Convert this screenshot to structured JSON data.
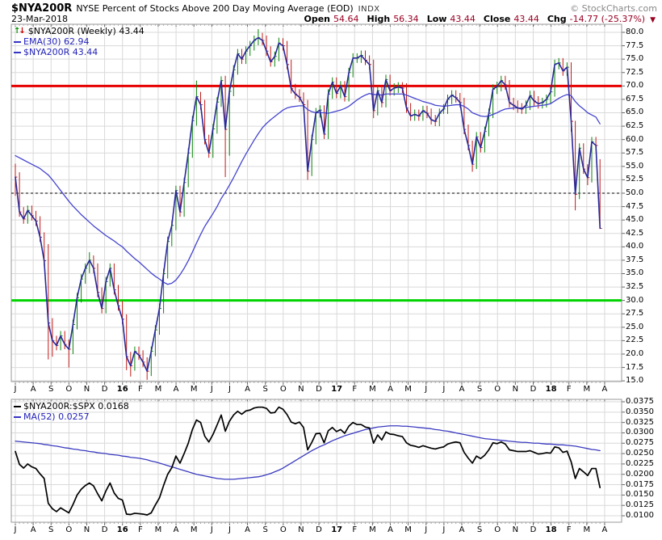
{
  "header": {
    "symbol": "$NYA200R",
    "title": "NYSE Percent of Stocks Above 200 Day Moving Average (EOD)",
    "exchange": "INDX",
    "watermark": "© StockCharts.com",
    "date": "23-Mar-2018",
    "quote": {
      "open_label": "Open",
      "open": "54.64",
      "high_label": "High",
      "high": "56.34",
      "low_label": "Low",
      "low": "43.44",
      "close_label": "Close",
      "close": "43.44",
      "chg_label": "Chg",
      "chg": "-14.77 (-25.37%)"
    }
  },
  "main_panel": {
    "legend": [
      {
        "label": "$NYA200R (Weekly) 43.44",
        "color": "#000000",
        "icon": "updown-arrows"
      },
      {
        "label": "EMA(30) 62.94",
        "color": "#2222bb",
        "icon": "line-sample"
      },
      {
        "label": "$NYA200R 43.44",
        "color": "#2222bb",
        "icon": "line-sample"
      }
    ],
    "y_ticks": [
      "80.0",
      "77.5",
      "75.0",
      "72.5",
      "70.0",
      "67.5",
      "65.0",
      "62.5",
      "60.0",
      "57.5",
      "55.0",
      "52.5",
      "50.0",
      "47.5",
      "45.0",
      "42.5",
      "40.0",
      "37.5",
      "35.0",
      "32.5",
      "30.0",
      "27.5",
      "25.0",
      "22.5",
      "20.0",
      "17.5",
      "15.0"
    ]
  },
  "lower_panel": {
    "legend": [
      {
        "label": "$NYA200R:$SPX 0.0168",
        "color": "#000000",
        "icon": "line-sample"
      },
      {
        "label": "MA(52) 0.0257",
        "color": "#2222bb",
        "icon": "line-sample"
      }
    ],
    "y_ticks": [
      "0.0375",
      "0.0350",
      "0.0325",
      "0.0300",
      "0.0275",
      "0.0250",
      "0.0225",
      "0.0200",
      "0.0175",
      "0.0150",
      "0.0125",
      "0.0100"
    ]
  },
  "x_axis": {
    "months": [
      "J",
      "A",
      "S",
      "O",
      "N",
      "D",
      "16",
      "F",
      "M",
      "A",
      "M",
      "J",
      "J",
      "A",
      "S",
      "O",
      "N",
      "D",
      "17",
      "F",
      "M",
      "A",
      "M",
      "J",
      "J",
      "A",
      "S",
      "O",
      "N",
      "D",
      "18",
      "F",
      "M",
      "A"
    ]
  },
  "chart_data": {
    "type": "ohlc+line",
    "frequency": "weekly",
    "x_range": "Jul-2015 to Apr-2018",
    "main": {
      "ylabel": "Percent of stocks above 200-day MA",
      "ylim": [
        15.0,
        80.0
      ],
      "grid_step": 2.5,
      "up_color": "#0a830a",
      "down_color": "#c11b17",
      "close_line_color": "#28289a",
      "ema_color": "#4444cf",
      "hlines": [
        {
          "value": 70.0,
          "color": "#e60000",
          "width": 3,
          "style": "solid"
        },
        {
          "value": 50.0,
          "color": "#000000",
          "width": 1,
          "style": "dashed"
        },
        {
          "value": 30.0,
          "color": "#00d300",
          "width": 3,
          "style": "solid"
        }
      ],
      "close": [
        53.0,
        46.5,
        45.2,
        46.8,
        45.8,
        44.8,
        41.8,
        37.4,
        25.8,
        22.5,
        21.6,
        23.4,
        21.8,
        20.9,
        25.5,
        30.5,
        34.0,
        36.0,
        37.5,
        36.0,
        31.5,
        28.5,
        33.5,
        36.0,
        32.0,
        29.0,
        26.5,
        19.5,
        17.8,
        20.5,
        19.8,
        18.5,
        16.8,
        20.5,
        24.5,
        28.5,
        35.0,
        41.0,
        44.0,
        50.5,
        46.5,
        52.0,
        57.5,
        63.5,
        68.0,
        66.5,
        60.0,
        57.5,
        62.0,
        67.0,
        71.0,
        61.9,
        69.0,
        73.0,
        76.0,
        75.0,
        76.5,
        77.5,
        78.5,
        79.0,
        78.5,
        76.5,
        74.5,
        75.5,
        78.0,
        77.5,
        74.0,
        69.5,
        68.5,
        67.9,
        66.5,
        54.1,
        60.0,
        65.0,
        65.5,
        61.0,
        68.5,
        70.7,
        68.6,
        70.0,
        68.0,
        72.5,
        75.2,
        75.2,
        75.7,
        74.8,
        74.0,
        65.4,
        69.1,
        66.9,
        71.2,
        69.1,
        69.6,
        69.8,
        69.6,
        65.9,
        64.4,
        64.7,
        64.4,
        65.4,
        64.9,
        63.7,
        63.4,
        64.9,
        65.7,
        67.5,
        68.3,
        67.8,
        66.9,
        61.9,
        58.9,
        55.4,
        60.5,
        58.5,
        61.5,
        64.9,
        69.4,
        69.9,
        71.0,
        70.2,
        66.9,
        66.4,
        65.9,
        65.7,
        66.4,
        68.2,
        67.2,
        66.7,
        66.9,
        67.5,
        68.9,
        74.0,
        74.3,
        72.8,
        73.5,
        63.4,
        49.8,
        58.4,
        54.5,
        52.9,
        59.6,
        58.9,
        43.44
      ],
      "high": [
        55.5,
        53.9,
        47.4,
        47.7,
        47.7,
        46.7,
        45.7,
        42.7,
        40.5,
        26.7,
        23.4,
        24.3,
        24.3,
        22.7,
        26.4,
        31.4,
        34.9,
        36.9,
        39.0,
        38.4,
        36.9,
        32.4,
        34.4,
        36.9,
        36.9,
        32.9,
        29.9,
        27.4,
        20.4,
        21.4,
        21.4,
        20.7,
        19.4,
        21.4,
        25.4,
        29.4,
        35.9,
        41.9,
        44.9,
        51.4,
        51.4,
        52.9,
        58.4,
        64.4,
        71.0,
        68.9,
        67.4,
        60.9,
        62.9,
        67.9,
        71.8,
        71.9,
        70.0,
        73.9,
        76.9,
        76.9,
        77.4,
        78.4,
        79.4,
        80.6,
        79.9,
        79.4,
        77.4,
        76.4,
        79.0,
        78.9,
        78.4,
        74.9,
        70.4,
        69.4,
        68.8,
        67.4,
        60.9,
        65.9,
        66.4,
        66.4,
        69.4,
        71.6,
        71.6,
        70.9,
        70.9,
        73.4,
        76.1,
        76.1,
        76.6,
        76.6,
        75.7,
        74.9,
        70.0,
        70.0,
        72.1,
        72.1,
        70.5,
        70.7,
        70.7,
        70.5,
        66.8,
        65.6,
        65.6,
        66.3,
        66.3,
        65.8,
        64.6,
        65.8,
        66.6,
        68.4,
        69.2,
        69.2,
        68.7,
        67.8,
        62.8,
        59.8,
        61.4,
        61.4,
        62.4,
        65.8,
        70.3,
        70.8,
        71.9,
        71.9,
        71.1,
        67.8,
        67.3,
        66.8,
        67.3,
        69.1,
        69.1,
        68.1,
        67.8,
        68.4,
        69.8,
        74.9,
        75.2,
        75.2,
        74.4,
        74.4,
        63.5,
        59.3,
        59.3,
        55.4,
        60.5,
        60.5,
        56.34
      ],
      "low": [
        49.5,
        45.6,
        44.3,
        44.3,
        44.9,
        43.9,
        40.9,
        36.5,
        19.0,
        19.5,
        20.7,
        20.7,
        20.9,
        17.5,
        20.0,
        24.6,
        29.6,
        33.1,
        35.1,
        35.1,
        30.6,
        27.6,
        27.6,
        32.6,
        31.1,
        28.1,
        25.6,
        17.0,
        15.8,
        16.9,
        18.9,
        17.6,
        15.2,
        15.9,
        19.6,
        23.6,
        27.6,
        34.1,
        40.1,
        43.1,
        45.6,
        45.6,
        51.1,
        56.6,
        62.6,
        65.6,
        59.1,
        56.6,
        56.6,
        61.1,
        66.1,
        53.0,
        57.0,
        68.1,
        72.1,
        74.1,
        74.1,
        75.6,
        76.6,
        77.6,
        77.6,
        75.6,
        73.6,
        73.6,
        74.6,
        76.6,
        73.1,
        68.6,
        67.6,
        67.0,
        65.6,
        52.5,
        53.2,
        59.1,
        64.1,
        60.1,
        60.1,
        67.6,
        67.7,
        67.7,
        67.1,
        67.1,
        71.6,
        74.3,
        74.3,
        73.9,
        73.1,
        64.0,
        64.5,
        66.0,
        66.0,
        68.2,
        68.2,
        68.7,
        68.7,
        65.0,
        63.5,
        63.5,
        63.5,
        63.5,
        64.0,
        62.8,
        62.5,
        62.5,
        64.8,
        64.8,
        66.6,
        66.9,
        66.0,
        61.0,
        58.0,
        54.0,
        54.5,
        57.6,
        57.6,
        60.6,
        64.0,
        68.5,
        69.0,
        69.3,
        66.0,
        65.5,
        65.0,
        64.8,
        64.8,
        65.5,
        66.3,
        65.8,
        65.8,
        66.0,
        66.6,
        68.0,
        73.1,
        71.9,
        71.9,
        61.5,
        46.8,
        48.9,
        53.6,
        51.5,
        52.0,
        58.0,
        43.44
      ],
      "ema30": [
        57.0,
        56.6,
        56.2,
        55.8,
        55.4,
        55.0,
        54.6,
        54.0,
        53.4,
        52.5,
        51.5,
        50.5,
        49.5,
        48.5,
        47.6,
        46.8,
        46.0,
        45.3,
        44.6,
        43.9,
        43.3,
        42.7,
        42.1,
        41.6,
        41.1,
        40.5,
        40.0,
        39.2,
        38.5,
        37.8,
        37.2,
        36.5,
        35.8,
        35.1,
        34.5,
        34.0,
        33.4,
        33.0,
        33.2,
        33.8,
        34.8,
        36.0,
        37.4,
        39.0,
        40.7,
        42.3,
        43.8,
        45.0,
        46.2,
        47.5,
        49.0,
        50.2,
        51.5,
        52.9,
        54.4,
        55.9,
        57.3,
        58.6,
        59.9,
        61.1,
        62.2,
        63.0,
        63.7,
        64.3,
        64.9,
        65.5,
        65.9,
        66.1,
        66.2,
        66.3,
        66.3,
        65.6,
        65.2,
        65.0,
        65.0,
        65.0,
        64.9,
        65.1,
        65.3,
        65.5,
        65.8,
        66.2,
        66.8,
        67.4,
        67.9,
        68.3,
        68.6,
        68.4,
        68.4,
        68.3,
        68.5,
        68.5,
        68.5,
        68.5,
        68.5,
        68.3,
        68.0,
        67.7,
        67.4,
        67.1,
        66.9,
        66.7,
        66.4,
        66.3,
        66.2,
        66.3,
        66.4,
        66.5,
        66.5,
        66.2,
        65.7,
        65.0,
        64.7,
        64.4,
        64.3,
        64.4,
        64.7,
        65.0,
        65.4,
        65.7,
        65.8,
        65.9,
        65.9,
        65.9,
        66.0,
        66.1,
        66.2,
        66.3,
        66.4,
        66.5,
        66.7,
        67.2,
        67.7,
        68.1,
        68.4,
        68.2,
        67.1,
        66.3,
        65.7,
        65.0,
        64.6,
        64.2,
        62.94
      ]
    },
    "lower": {
      "ylabel": "$NYA200R:$SPX ratio",
      "ylim": [
        0.01,
        0.0375
      ],
      "grid_step": 0.0025,
      "ratio_color": "#000000",
      "ma_color": "#3a3ac0",
      "ratio": [
        0.0255,
        0.0224,
        0.0215,
        0.0225,
        0.0218,
        0.0214,
        0.0201,
        0.019,
        0.013,
        0.0117,
        0.011,
        0.0119,
        0.0113,
        0.0107,
        0.0127,
        0.015,
        0.0164,
        0.0173,
        0.0179,
        0.0172,
        0.0153,
        0.0136,
        0.016,
        0.0179,
        0.0155,
        0.0142,
        0.0138,
        0.0104,
        0.0103,
        0.0106,
        0.0105,
        0.0104,
        0.0102,
        0.0107,
        0.0126,
        0.0143,
        0.0173,
        0.02,
        0.0216,
        0.0244,
        0.0227,
        0.025,
        0.0275,
        0.0308,
        0.0331,
        0.0325,
        0.0292,
        0.0278,
        0.0296,
        0.0319,
        0.0343,
        0.0304,
        0.0328,
        0.0343,
        0.0352,
        0.0345,
        0.0353,
        0.0355,
        0.036,
        0.0362,
        0.0362,
        0.0359,
        0.0348,
        0.0349,
        0.0362,
        0.0357,
        0.0344,
        0.0326,
        0.0322,
        0.0326,
        0.0313,
        0.0259,
        0.0277,
        0.0298,
        0.0299,
        0.0276,
        0.0305,
        0.0313,
        0.0303,
        0.0308,
        0.0299,
        0.0316,
        0.0325,
        0.032,
        0.032,
        0.0314,
        0.0312,
        0.0275,
        0.0295,
        0.0283,
        0.0302,
        0.0297,
        0.0296,
        0.0293,
        0.0291,
        0.0276,
        0.027,
        0.0268,
        0.0265,
        0.0269,
        0.0266,
        0.0263,
        0.0261,
        0.0264,
        0.0266,
        0.0273,
        0.0276,
        0.0278,
        0.0276,
        0.0253,
        0.0239,
        0.0227,
        0.0244,
        0.0238,
        0.0246,
        0.0259,
        0.0276,
        0.0274,
        0.0278,
        0.0273,
        0.0259,
        0.0257,
        0.0255,
        0.0255,
        0.0255,
        0.0257,
        0.0253,
        0.0249,
        0.025,
        0.0252,
        0.0251,
        0.0266,
        0.0264,
        0.0253,
        0.0256,
        0.023,
        0.019,
        0.0214,
        0.0206,
        0.0197,
        0.0214,
        0.0214,
        0.0168
      ],
      "ma52": [
        0.028,
        0.0279,
        0.0278,
        0.0277,
        0.0276,
        0.0275,
        0.0274,
        0.0272,
        0.0271,
        0.0269,
        0.0268,
        0.0266,
        0.0264,
        0.0263,
        0.0261,
        0.026,
        0.0258,
        0.0257,
        0.0255,
        0.0254,
        0.0252,
        0.0251,
        0.025,
        0.0248,
        0.0247,
        0.0246,
        0.0244,
        0.0243,
        0.0241,
        0.024,
        0.0239,
        0.0237,
        0.0235,
        0.0232,
        0.023,
        0.0227,
        0.0224,
        0.0221,
        0.0218,
        0.0215,
        0.0212,
        0.0209,
        0.0206,
        0.0203,
        0.02,
        0.0198,
        0.0196,
        0.0194,
        0.0192,
        0.019,
        0.0189,
        0.0188,
        0.0188,
        0.0188,
        0.0189,
        0.019,
        0.0191,
        0.0192,
        0.0193,
        0.0194,
        0.0196,
        0.0199,
        0.0202,
        0.0206,
        0.021,
        0.0215,
        0.0221,
        0.0227,
        0.0233,
        0.0239,
        0.0245,
        0.0251,
        0.0257,
        0.0262,
        0.0267,
        0.0271,
        0.0276,
        0.0281,
        0.0285,
        0.0289,
        0.0293,
        0.0296,
        0.0299,
        0.0302,
        0.0305,
        0.0308,
        0.031,
        0.0312,
        0.0314,
        0.0315,
        0.0316,
        0.0317,
        0.0317,
        0.0317,
        0.0316,
        0.0316,
        0.0315,
        0.0314,
        0.0313,
        0.0312,
        0.0311,
        0.031,
        0.0308,
        0.0307,
        0.0305,
        0.0304,
        0.0302,
        0.03,
        0.0298,
        0.0296,
        0.0294,
        0.0292,
        0.029,
        0.0288,
        0.0286,
        0.0285,
        0.0284,
        0.0283,
        0.0282,
        0.0281,
        0.028,
        0.0279,
        0.0278,
        0.0277,
        0.0277,
        0.0276,
        0.0275,
        0.0275,
        0.0274,
        0.0273,
        0.0273,
        0.0272,
        0.0271,
        0.0271,
        0.027,
        0.0269,
        0.0268,
        0.0266,
        0.0264,
        0.0262,
        0.026,
        0.0259,
        0.0257
      ]
    }
  }
}
